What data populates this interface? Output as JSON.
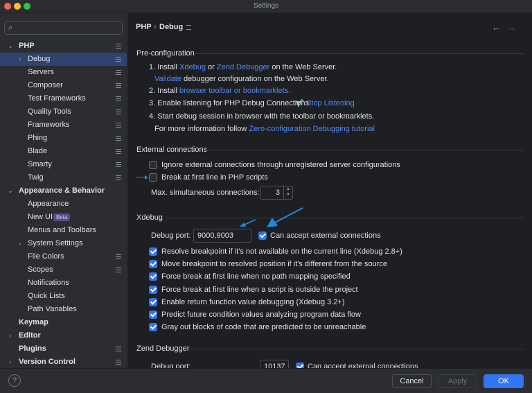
{
  "window": {
    "title": "Settings"
  },
  "sidebar": {
    "search_placeholder": "",
    "items": [
      {
        "label": "PHP",
        "bold": true,
        "expanded": true
      },
      {
        "label": "Debug",
        "selected": true
      },
      {
        "label": "Servers"
      },
      {
        "label": "Composer"
      },
      {
        "label": "Test Frameworks"
      },
      {
        "label": "Quality Tools"
      },
      {
        "label": "Frameworks"
      },
      {
        "label": "Phing"
      },
      {
        "label": "Blade"
      },
      {
        "label": "Smarty"
      },
      {
        "label": "Twig"
      },
      {
        "label": "Appearance & Behavior",
        "bold": true,
        "expanded": true
      },
      {
        "label": "Appearance"
      },
      {
        "label": "New UI",
        "badge": "Beta"
      },
      {
        "label": "Menus and Toolbars"
      },
      {
        "label": "System Settings"
      },
      {
        "label": "File Colors"
      },
      {
        "label": "Scopes"
      },
      {
        "label": "Notifications"
      },
      {
        "label": "Quick Lists"
      },
      {
        "label": "Path Variables"
      },
      {
        "label": "Keymap",
        "bold": true
      },
      {
        "label": "Editor",
        "bold": true
      },
      {
        "label": "Plugins",
        "bold": true
      },
      {
        "label": "Version Control",
        "bold": true
      }
    ]
  },
  "header": {
    "breadcrumb_parent": "PHP",
    "breadcrumb_sep": "›",
    "breadcrumb_current": "Debug",
    "back_icon": "←",
    "forward_icon": "→"
  },
  "preconfig": {
    "title": "Pre-configuration",
    "step1_prefix": "1. Install",
    "step1_link1": "Xdebug",
    "step1_or": "or",
    "step1_link2": "Zend Debugger",
    "step1_suffix": "on the Web Server.",
    "step1b_link": "Validate",
    "step1b_suffix": "debugger configuration on the Web Server.",
    "step2_prefix": "2. Install",
    "step2_link": "browser toolbar or bookmarklets.",
    "step3_prefix": "3. Enable listening for PHP Debug Connections:",
    "step3_link": "Stop Listening",
    "step4": "4. Start debug session in browser with the toolbar or bookmarklets.",
    "step4b_prefix": "For more information follow",
    "step4b_link": "Zero-configuration Debugging tutorial"
  },
  "external": {
    "title": "External connections",
    "ignore_label": "Ignore external connections through unregistered server configurations",
    "ignore_checked": false,
    "break_label": "Break at first line in PHP scripts",
    "break_checked": false,
    "max_label": "Max. simultaneous connections:",
    "max_value": "3"
  },
  "xdebug": {
    "title": "Xdebug",
    "port_label": "Debug port:",
    "port_value": "9000,9003",
    "accept_label": "Can accept external connections",
    "options": [
      "Resolve breakpoint if it's not available on the current line (Xdebug 2.8+)",
      "Move breakpoint to resolved position if it's different from the source",
      "Force break at first line when no path mapping specified",
      "Force break at first line when a script is outside the project",
      "Enable return function value debugging (Xdebug 3.2+)",
      "Predict future condition values analyzing program data flow",
      "Gray out blocks of code that are predicted to be unreachable"
    ]
  },
  "zend": {
    "title": "Zend Debugger",
    "port_label": "Debug port:",
    "port_value": "10137",
    "accept_label": "Can accept external connections"
  },
  "footer": {
    "help": "?",
    "cancel": "Cancel",
    "apply": "Apply",
    "ok": "OK"
  },
  "colors": {
    "accent": "#3574f0",
    "link": "#548af7",
    "selection": "#2e436e"
  }
}
